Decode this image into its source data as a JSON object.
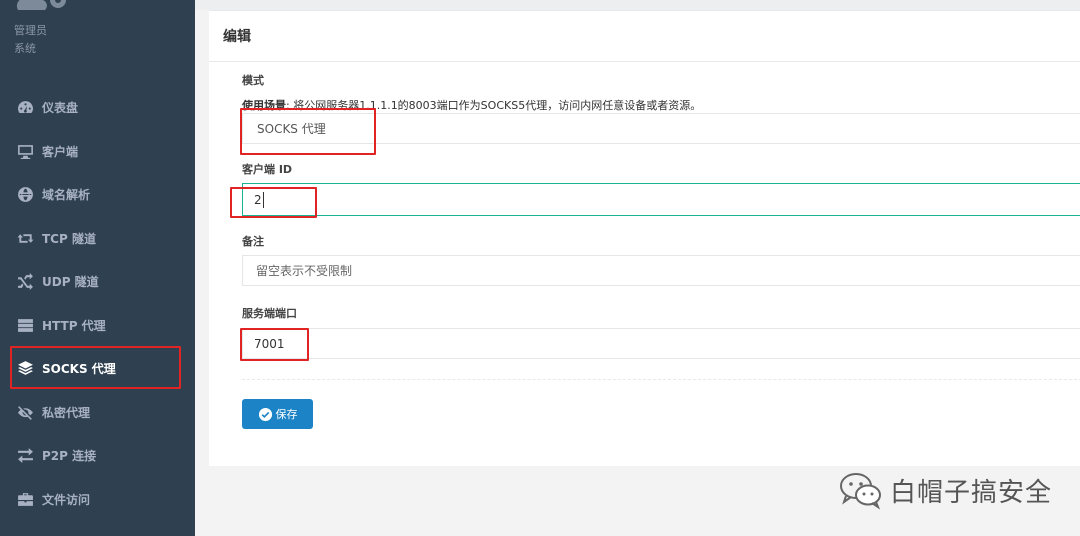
{
  "sidebar": {
    "role": "管理员",
    "system": "系统",
    "items": [
      {
        "label": "仪表盘",
        "icon": "dashboard-icon"
      },
      {
        "label": "客户端",
        "icon": "desktop-icon"
      },
      {
        "label": "域名解析",
        "icon": "globe-icon"
      },
      {
        "label": "TCP 隧道",
        "icon": "retweet-icon"
      },
      {
        "label": "UDP 隧道",
        "icon": "random-icon"
      },
      {
        "label": "HTTP 代理",
        "icon": "server-icon"
      },
      {
        "label": "SOCKS 代理",
        "icon": "layers-icon"
      },
      {
        "label": "私密代理",
        "icon": "eye-slash-icon"
      },
      {
        "label": "P2P 连接",
        "icon": "exchange-icon"
      },
      {
        "label": "文件访问",
        "icon": "briefcase-icon"
      }
    ]
  },
  "card": {
    "title": "编辑"
  },
  "form": {
    "mode_label": "模式",
    "hint_prefix": "使用场景",
    "hint_text": ": 将公网服务器1.1.1.1的8003端口作为SOCKS5代理，访问内网任意设备或者资源。",
    "mode_value": "SOCKS 代理",
    "client_id_label": "客户端 ID",
    "client_id_value": "2",
    "remark_label": "备注",
    "remark_placeholder": "留空表示不受限制",
    "port_label": "服务端端口",
    "port_value": "7001",
    "save_label": "保存"
  },
  "watermark": {
    "text": "白帽子搞安全"
  },
  "colors": {
    "sidebar_bg": "#2f4050",
    "primary": "#1c84c6",
    "focus_border": "#1ab394",
    "highlight": "#e02424"
  }
}
